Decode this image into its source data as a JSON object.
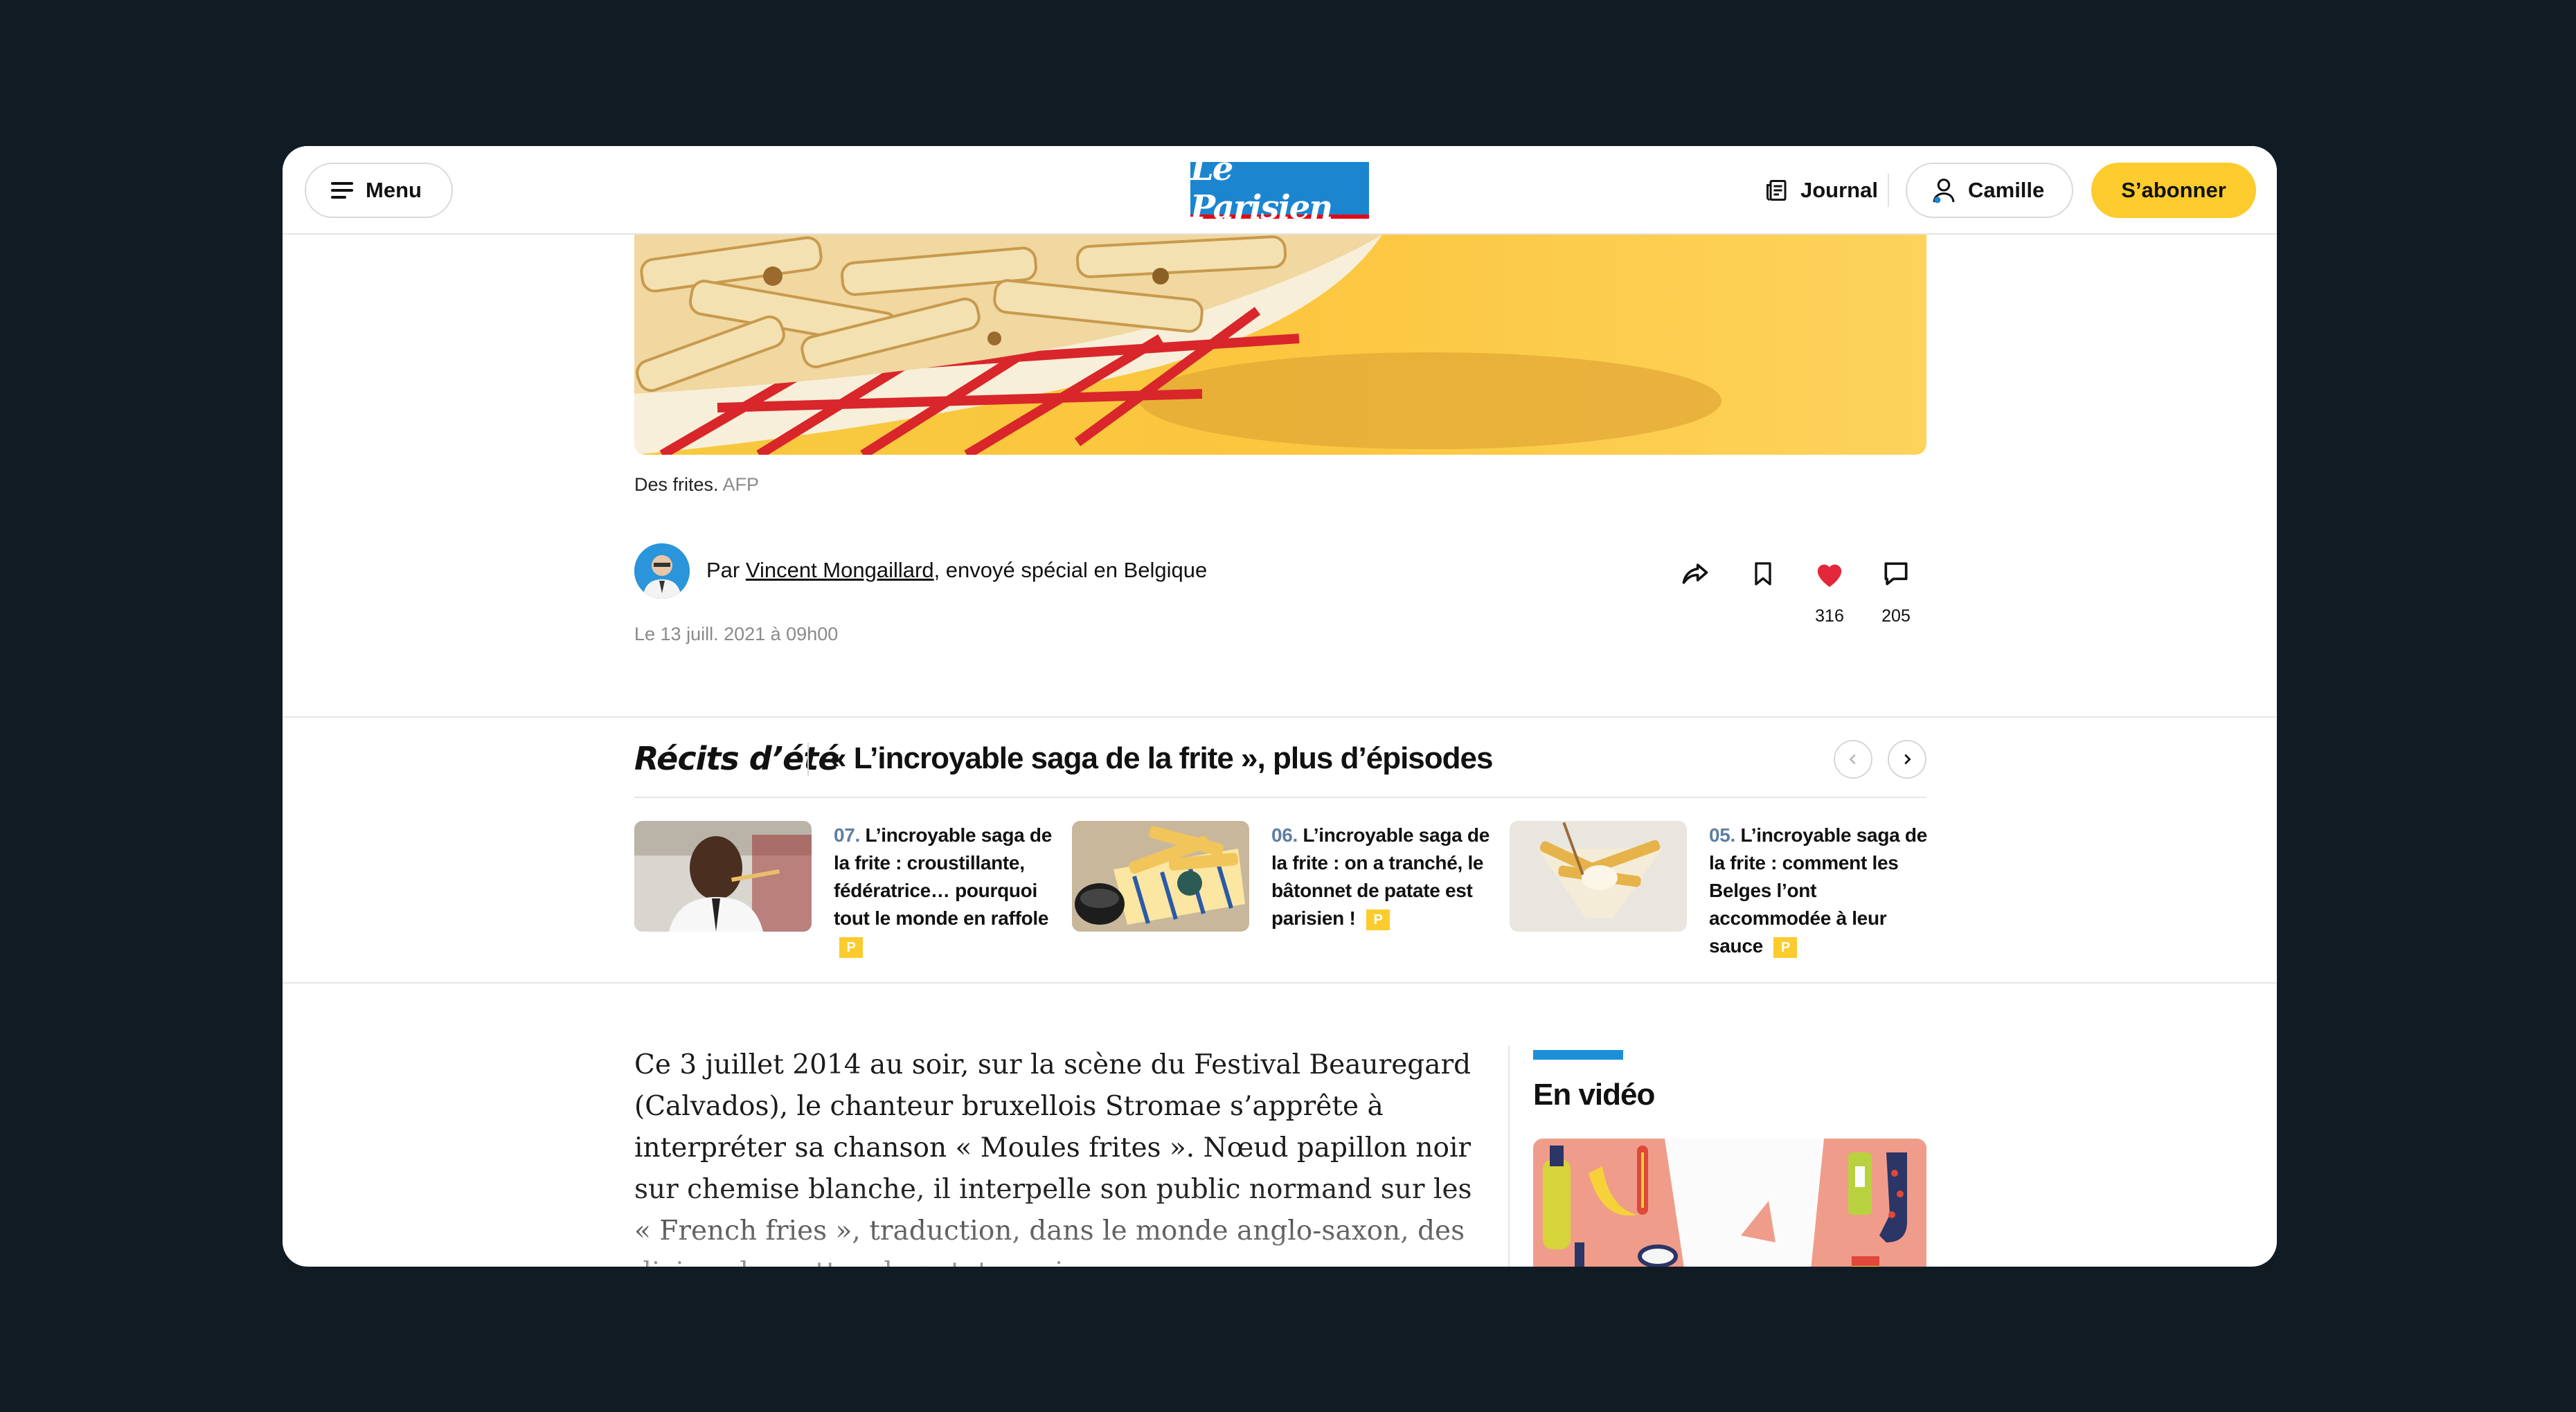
{
  "header": {
    "menu_label": "Menu",
    "logo_text": "Le Parisien",
    "journal_label": "Journal",
    "account_label": "Camille",
    "subscribe_label": "S’abonner"
  },
  "hero": {
    "caption": "Des frites.",
    "credit": "AFP"
  },
  "byline": {
    "prefix": "Par ",
    "author": "Vincent Mongaillard",
    "role": ", envoyé spécial en Belgique",
    "date": "Le 13 juill. 2021 à 09h00"
  },
  "actions": {
    "likes": "316",
    "comments": "205"
  },
  "series": {
    "name": "Récits d’été",
    "title": "« L’incroyable saga de la frite », plus d’épisodes",
    "cards": [
      {
        "num": "07.",
        "title": "L’incroyable saga de la frite : croustillante, fédératrice… pourquoi tout le monde en raffole",
        "badge": "P"
      },
      {
        "num": "06.",
        "title": "L’incroyable saga de la frite : on a tranché, le bâtonnet de patate est parisien !",
        "badge": "P"
      },
      {
        "num": "05.",
        "title": "L’incroyable saga de la frite : comment les Belges l’ont accommodée à leur sauce",
        "badge": "P"
      }
    ]
  },
  "article": {
    "text": "Ce 3 juillet 2014 au soir, sur la scène du Festival Beauregard (Calvados), le chanteur bruxellois Stromae s’apprête à interpréter sa chanson « Moules frites ». Nœud papillon noir sur chemise blanche, il interpelle son public normand sur les « French fries », traduction, dans le monde anglo-saxon, des divines barrettes de patate moins"
  },
  "sidebar": {
    "video_title": "En vidéo"
  },
  "colors": {
    "brand_blue": "#1c85d0",
    "accent_yellow": "#fccb2d",
    "like_red": "#e3283a",
    "background": "#111b24"
  }
}
